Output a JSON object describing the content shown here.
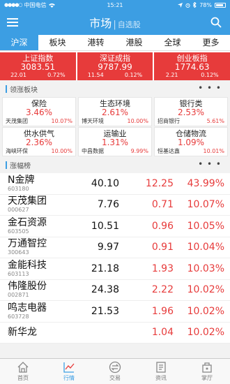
{
  "status_bar": {
    "carrier": "中国电信",
    "time": "15:21",
    "battery": "78%"
  },
  "nav": {
    "title": "市场",
    "subtitle": "自选股"
  },
  "tabs": [
    "沪深",
    "板块",
    "港股",
    "港股",
    "全球",
    "更多"
  ],
  "indices": [
    {
      "name": "上证指数",
      "value": "3083.51",
      "change": "22.01",
      "pct": "0.72%"
    },
    {
      "name": "深证成指",
      "value": "9787.99",
      "change": "11.54",
      "pct": "0.12%"
    },
    {
      "name": "创业板指",
      "value": "1774.63",
      "change": "2.21",
      "pct": "0.12%"
    }
  ],
  "sectors_header": "领涨板块",
  "more_dots": "• • •",
  "sectors": [
    {
      "name": "保险",
      "pct": "3.46%",
      "stock": "天茂集团",
      "stock_pct": "10.07%"
    },
    {
      "name": "生态环境",
      "pct": "2.61%",
      "stock": "博天环境",
      "stock_pct": "10.00%"
    },
    {
      "name": "银行类",
      "pct": "2.53%",
      "stock": "招商银行",
      "stock_pct": "5.61%"
    },
    {
      "name": "供水供气",
      "pct": "2.36%",
      "stock": "海峡环保",
      "stock_pct": "10.00%"
    },
    {
      "name": "运输业",
      "pct": "1.31%",
      "stock": "中昌数据",
      "stock_pct": "9.99%"
    },
    {
      "name": "仓储物流",
      "pct": "1.09%",
      "stock": "恒基达鑫",
      "stock_pct": "10.01%"
    }
  ],
  "gainers_header": "涨幅榜",
  "stocks": [
    {
      "name": "N金牌",
      "code": "603180",
      "price": "40.10",
      "change": "12.25",
      "pct": "43.99%"
    },
    {
      "name": "天茂集团",
      "code": "000627",
      "price": "7.76",
      "change": "0.71",
      "pct": "10.07%"
    },
    {
      "name": "金石资源",
      "code": "603505",
      "price": "10.51",
      "change": "0.96",
      "pct": "10.05%"
    },
    {
      "name": "万通智控",
      "code": "300643",
      "price": "9.97",
      "change": "0.91",
      "pct": "10.04%"
    },
    {
      "name": "金能科技",
      "code": "603113",
      "price": "21.18",
      "change": "1.93",
      "pct": "10.03%"
    },
    {
      "name": "伟隆股份",
      "code": "002871",
      "price": "24.38",
      "change": "2.22",
      "pct": "10.02%"
    },
    {
      "name": "鸣志电器",
      "code": "603728",
      "price": "21.53",
      "change": "1.96",
      "pct": "10.02%"
    },
    {
      "name": "新华龙",
      "code": "",
      "price": "",
      "change": "1.04",
      "pct": "10.02%"
    }
  ],
  "bottom_nav": [
    "首页",
    "行情",
    "交易",
    "资讯",
    "掌厅"
  ],
  "colors": {
    "accent": "#3c9ee3",
    "up": "#e73b3b"
  }
}
